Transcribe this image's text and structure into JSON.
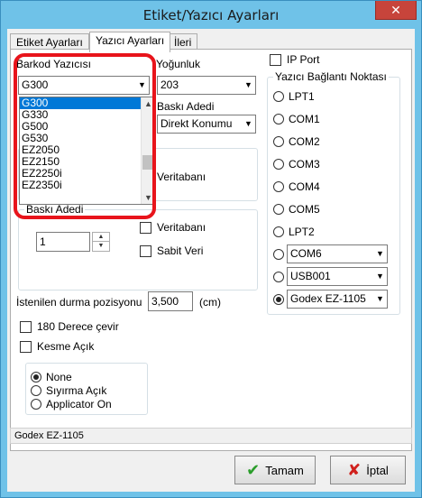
{
  "window": {
    "title": "Etiket/Yazıcı Ayarları",
    "close_label": "✕"
  },
  "tabs": [
    {
      "label": "Etiket Ayarları"
    },
    {
      "label": "Yazıcı Ayarları"
    },
    {
      "label": "İleri"
    }
  ],
  "left": {
    "barcode_printer_label": "Barkod Yazıcısı",
    "printer_selected": "G300",
    "printer_options": [
      "G300",
      "G330",
      "G500",
      "G530",
      "EZ2050",
      "EZ2150",
      "EZ2250i",
      "EZ2350i"
    ],
    "density_label": "Yoğunluk",
    "density_value": "203",
    "print_count_label": "Baskı Adedi",
    "print_count_mode": "Direkt Konumu",
    "database_label": "Veritabanı",
    "copies_group_title": "Baskı Adedi",
    "copies_value": "1",
    "copies_database_label": "Veritabanı",
    "fixed_data_label": "Sabit Veri",
    "stop_position_label": "İstenilen durma pozisyonu",
    "stop_position_value": "3,500",
    "stop_position_unit": "(cm)",
    "rotate_label": "180 Derece çevir",
    "cut_label": "Kesme Açık",
    "mode_options": [
      "None",
      "Sıyırma Açık",
      "Applicator On"
    ]
  },
  "right": {
    "ip_port_label": "IP Port",
    "connection_group_title": "Yazıcı Bağlantı Noktası",
    "ports": [
      "LPT1",
      "COM1",
      "COM2",
      "COM3",
      "COM4",
      "COM5",
      "LPT2"
    ],
    "com_select": "COM6",
    "usb_select": "USB001",
    "driver_select": "Godex EZ-1105"
  },
  "status": {
    "text": "Godex EZ-1105"
  },
  "buttons": {
    "ok_label": "Tamam",
    "cancel_label": "İptal"
  },
  "colors": {
    "highlight": "#e8141b",
    "selection": "#0078d7",
    "titlebar": "#6fc2e8"
  }
}
